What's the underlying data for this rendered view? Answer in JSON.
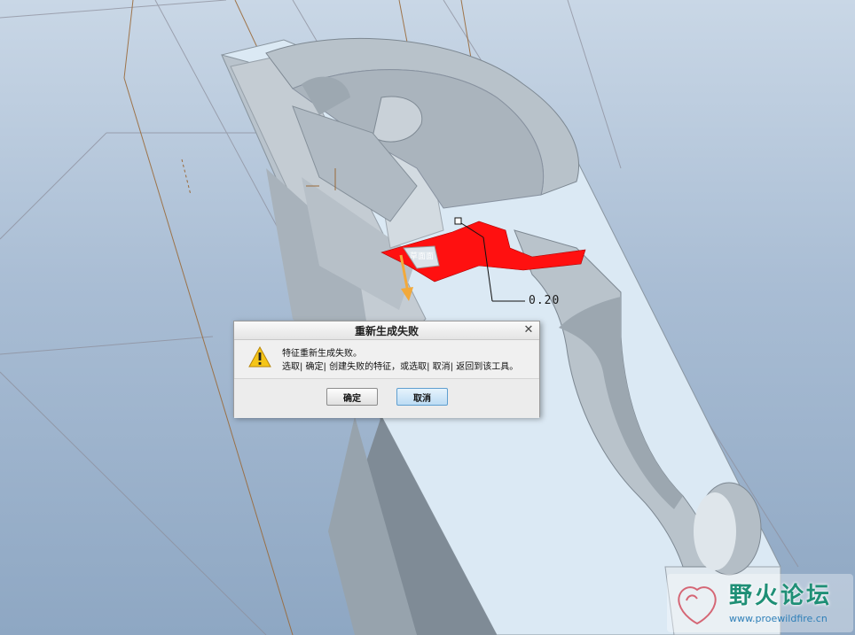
{
  "viewport": {
    "dimension_value": "0.20",
    "surface_tag": "草面面",
    "highlight_color": "#ff1010",
    "arrow_color": "#f2a93b",
    "model_color": "#c9d2d9",
    "datum_line_color": "#9a6a3a"
  },
  "dialog": {
    "title": "重新生成失败",
    "close_label": "✕",
    "icon": "warning-icon",
    "message_line1": "特征重新生成失败。",
    "message_line2": "选取| 确定| 创建失败的特征，或选取| 取消| 返回到该工具。",
    "ok_label": "确定",
    "cancel_label": "取消"
  },
  "watermark": {
    "title": "野火论坛",
    "url": "www.proewildfire.cn"
  }
}
